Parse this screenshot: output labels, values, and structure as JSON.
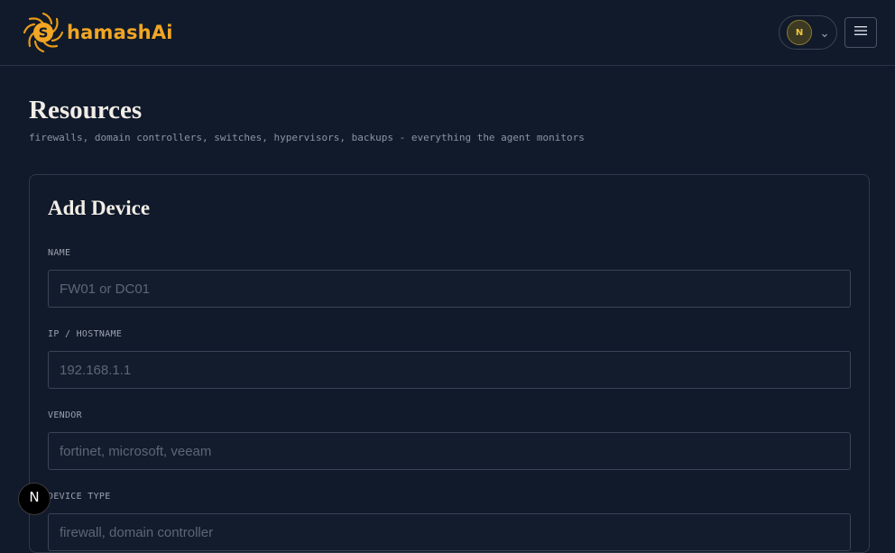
{
  "header": {
    "brand": "hamashAi",
    "brand_color": "#f2a623",
    "user_initial": "N",
    "logo_icon": "sun-s-logo-icon",
    "user_menu_icon": "chevron-down-icon",
    "menu_icon": "hamburger-menu-icon"
  },
  "page": {
    "title": "Resources",
    "subtitle": "firewalls, domain controllers, switches, hypervisors, backups - everything the agent monitors"
  },
  "form": {
    "title": "Add Device",
    "fields": [
      {
        "label": "NAME",
        "placeholder": "FW01 or DC01",
        "value": ""
      },
      {
        "label": "IP / HOSTNAME",
        "placeholder": "192.168.1.1",
        "value": ""
      },
      {
        "label": "VENDOR",
        "placeholder": "fortinet, microsoft, veeam",
        "value": ""
      },
      {
        "label": "DEVICE TYPE",
        "placeholder": "firewall, domain controller",
        "value": ""
      }
    ]
  },
  "dev_badge": {
    "letter": "N",
    "icon": "nextjs-n-icon"
  }
}
